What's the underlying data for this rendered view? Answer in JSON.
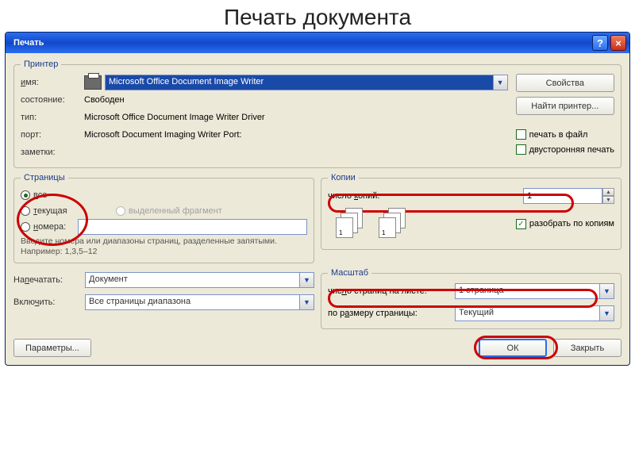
{
  "slide_title": "Печать документа",
  "dialog": {
    "title": "Печать"
  },
  "printer": {
    "legend": "Принтер",
    "name_label": "имя:",
    "name_value": "Microsoft Office Document Image Writer",
    "state_label": "состояние:",
    "state_value": "Свободен",
    "type_label": "тип:",
    "type_value": "Microsoft Office Document Image Writer Driver",
    "port_label": "порт:",
    "port_value": "Microsoft Document Imaging Writer Port:",
    "notes_label": "заметки:",
    "notes_value": "",
    "properties_btn": "Свойства",
    "find_btn": "Найти принтер...",
    "to_file_label": "печать в файл",
    "duplex_label": "двусторонняя печать"
  },
  "pages": {
    "legend": "Страницы",
    "all": "все",
    "current": "текущая",
    "selection": "выделенный фрагмент",
    "numbers": "номера:",
    "hint": "Введите номера или диапазоны страниц, разделенные запятыми. Например: 1,3,5–12"
  },
  "copies": {
    "legend": "Копии",
    "count_label": "число копий:",
    "count_value": "1",
    "collate": "разобрать по копиям"
  },
  "what": {
    "print_label": "Напечатать:",
    "print_value": "Документ",
    "include_label": "Включить:",
    "include_value": "Все страницы диапазона"
  },
  "scale": {
    "legend": "Масштаб",
    "per_sheet_label": "число страниц на листе:",
    "per_sheet_value": "1 страница",
    "fit_label": "по размеру страницы:",
    "fit_value": "Текущий"
  },
  "footer": {
    "options": "Параметры...",
    "ok": "ОК",
    "close": "Закрыть"
  }
}
